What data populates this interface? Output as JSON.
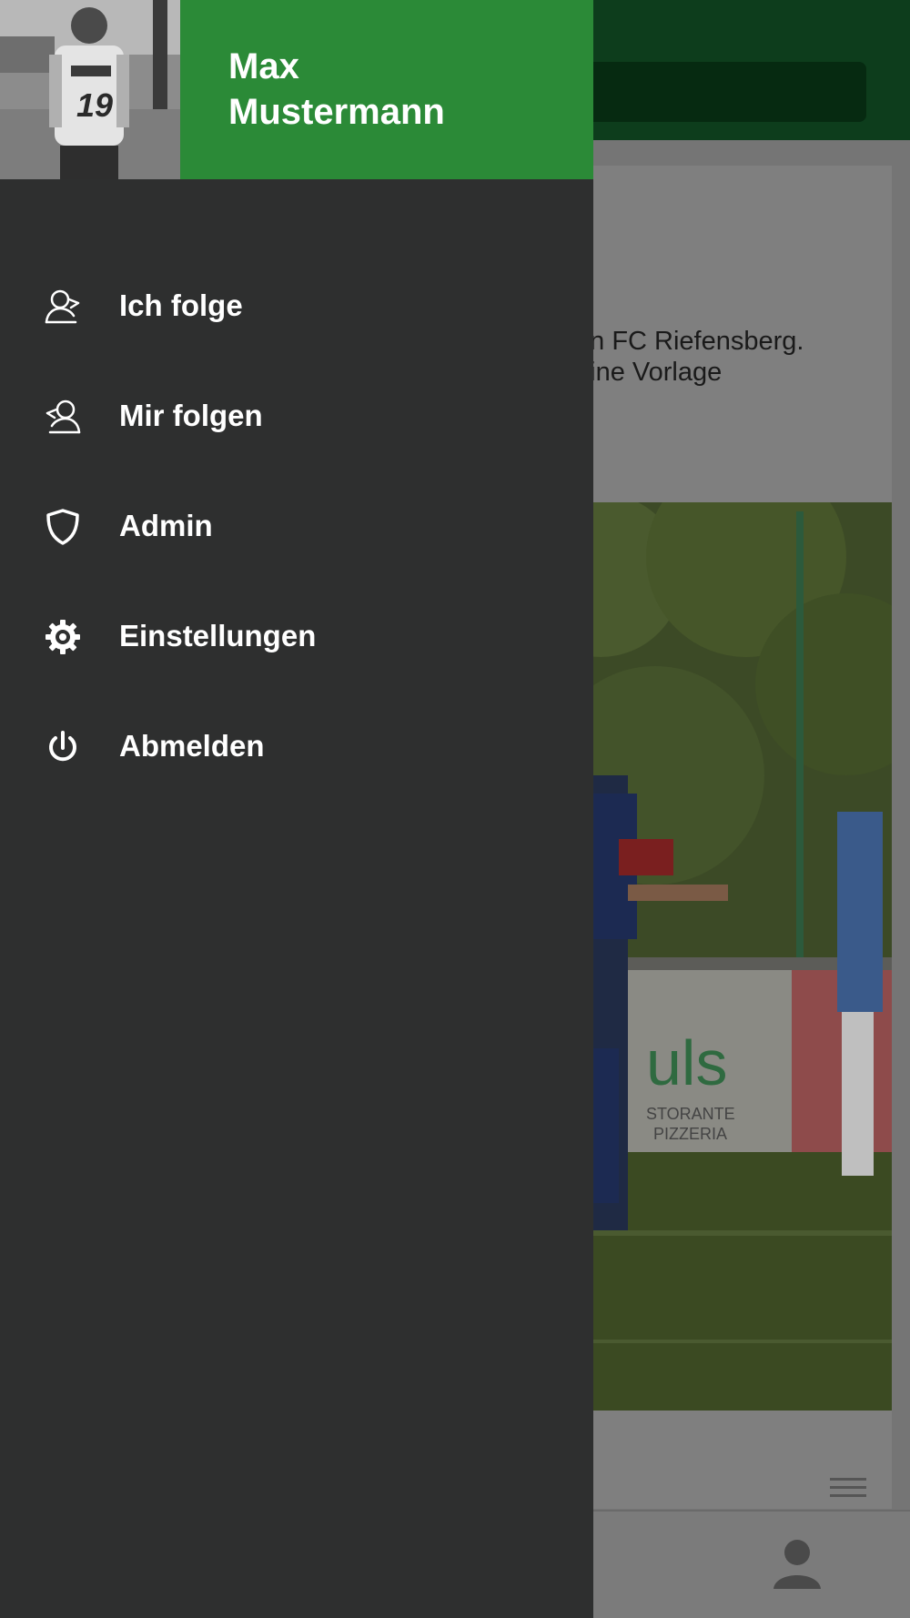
{
  "user": {
    "name": "Max\nMustermann"
  },
  "menu": {
    "items": [
      {
        "label": "Ich folge",
        "icon": "person-follow-icon"
      },
      {
        "label": "Mir folgen",
        "icon": "person-followers-icon"
      },
      {
        "label": "Admin",
        "icon": "shield-icon"
      },
      {
        "label": "Einstellungen",
        "icon": "gear-icon"
      },
      {
        "label": "Abmelden",
        "icon": "power-icon"
      }
    ]
  },
  "background": {
    "post_text": "en FC Riefensberg.\neine Vorlage"
  },
  "colors": {
    "brand_green": "#2b8a37",
    "drawer_bg": "#2e2f2f",
    "scrim_header": "#0d3d1c"
  }
}
